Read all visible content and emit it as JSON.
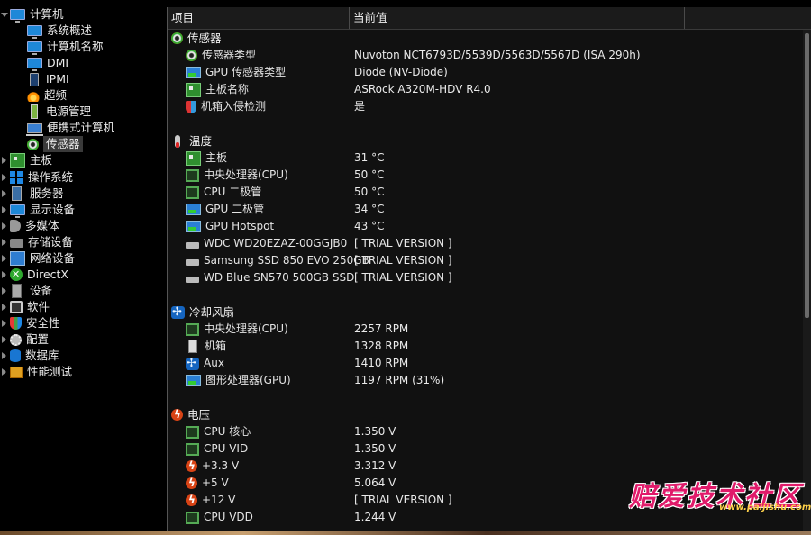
{
  "tree": {
    "items": [
      {
        "label": "计算机",
        "icon": "computer-icon",
        "level": 0,
        "expanded": true
      },
      {
        "label": "系统概述",
        "icon": "monitor-icon",
        "level": 1
      },
      {
        "label": "计算机名称",
        "icon": "monitor-icon",
        "level": 1
      },
      {
        "label": "DMI",
        "icon": "monitor-icon",
        "level": 1
      },
      {
        "label": "IPMI",
        "icon": "phone-icon",
        "level": 1
      },
      {
        "label": "超频",
        "icon": "fire-icon",
        "level": 1
      },
      {
        "label": "电源管理",
        "icon": "power-icon",
        "level": 1
      },
      {
        "label": "便携式计算机",
        "icon": "laptop-icon",
        "level": 1
      },
      {
        "label": "传感器",
        "icon": "sensor-icon",
        "level": 1,
        "selected": true
      },
      {
        "label": "主板",
        "icon": "motherboard-icon",
        "level": 0
      },
      {
        "label": "操作系统",
        "icon": "windows-icon",
        "level": 0
      },
      {
        "label": "服务器",
        "icon": "server-icon",
        "level": 0
      },
      {
        "label": "显示设备",
        "icon": "display-icon",
        "level": 0
      },
      {
        "label": "多媒体",
        "icon": "speaker-icon",
        "level": 0
      },
      {
        "label": "存储设备",
        "icon": "storage-icon",
        "level": 0
      },
      {
        "label": "网络设备",
        "icon": "network-icon",
        "level": 0
      },
      {
        "label": "DirectX",
        "icon": "xbox-icon",
        "level": 0
      },
      {
        "label": "设备",
        "icon": "device-icon",
        "level": 0
      },
      {
        "label": "软件",
        "icon": "software-icon",
        "level": 0
      },
      {
        "label": "安全性",
        "icon": "security-icon",
        "level": 0
      },
      {
        "label": "配置",
        "icon": "gear-icon",
        "level": 0
      },
      {
        "label": "数据库",
        "icon": "database-icon",
        "level": 0
      },
      {
        "label": "性能测试",
        "icon": "benchmark-icon",
        "level": 0
      }
    ]
  },
  "header": {
    "col1": "项目",
    "col2": "当前值"
  },
  "sections": [
    {
      "title": "传感器",
      "icon": "sensor-icon",
      "rows": [
        {
          "label": "传感器类型",
          "icon": "sensor-icon",
          "value": "Nuvoton NCT6793D/5539D/5563D/5567D  (ISA 290h)"
        },
        {
          "label": "GPU 传感器类型",
          "icon": "gpu-icon",
          "value": "Diode  (NV-Diode)"
        },
        {
          "label": "主板名称",
          "icon": "motherboard-icon",
          "value": "ASRock A320M-HDV R4.0"
        },
        {
          "label": "机箱入侵检测",
          "icon": "shield-icon",
          "value": "是"
        }
      ]
    },
    {
      "title": "温度",
      "icon": "thermometer-icon",
      "rows": [
        {
          "label": "主板",
          "icon": "motherboard-icon",
          "value": "31 °C"
        },
        {
          "label": "中央处理器(CPU)",
          "icon": "chip-icon",
          "value": "50 °C"
        },
        {
          "label": "CPU 二极管",
          "icon": "chip-icon",
          "value": "50 °C"
        },
        {
          "label": "GPU 二极管",
          "icon": "gpu-icon",
          "value": "34 °C"
        },
        {
          "label": "GPU Hotspot",
          "icon": "gpu-icon",
          "value": "43 °C"
        },
        {
          "label": "WDC WD20EZAZ-00GGJB0",
          "icon": "disk-icon",
          "value": "[ TRIAL VERSION ]"
        },
        {
          "label": "Samsung SSD 850 EVO 250GB",
          "icon": "disk-icon",
          "value": "[ TRIAL VERSION ]"
        },
        {
          "label": "WD Blue SN570 500GB SSD",
          "icon": "disk-icon",
          "value": "[ TRIAL VERSION ]"
        }
      ]
    },
    {
      "title": "冷却风扇",
      "icon": "fan-icon",
      "rows": [
        {
          "label": "中央处理器(CPU)",
          "icon": "chip-icon",
          "value": "2257 RPM"
        },
        {
          "label": "机箱",
          "icon": "case-icon",
          "value": "1328 RPM"
        },
        {
          "label": "Aux",
          "icon": "fan-icon",
          "value": "1410 RPM"
        },
        {
          "label": "图形处理器(GPU)",
          "icon": "gpu-icon",
          "value": "1197 RPM  (31%)"
        }
      ]
    },
    {
      "title": "电压",
      "icon": "voltage-icon",
      "rows": [
        {
          "label": "CPU 核心",
          "icon": "chip-icon",
          "value": "1.350 V"
        },
        {
          "label": "CPU VID",
          "icon": "chip-icon",
          "value": "1.350 V"
        },
        {
          "label": "+3.3 V",
          "icon": "voltage-icon",
          "value": "3.312 V"
        },
        {
          "label": "+5 V",
          "icon": "voltage-icon",
          "value": "5.064 V"
        },
        {
          "label": "+12 V",
          "icon": "voltage-icon",
          "value": "[ TRIAL VERSION ]"
        },
        {
          "label": "CPU VDD",
          "icon": "chip-icon",
          "value": "1.244 V"
        }
      ]
    }
  ],
  "watermark": {
    "text": "赔爱技术社区",
    "url": "www.paijishu.com"
  }
}
